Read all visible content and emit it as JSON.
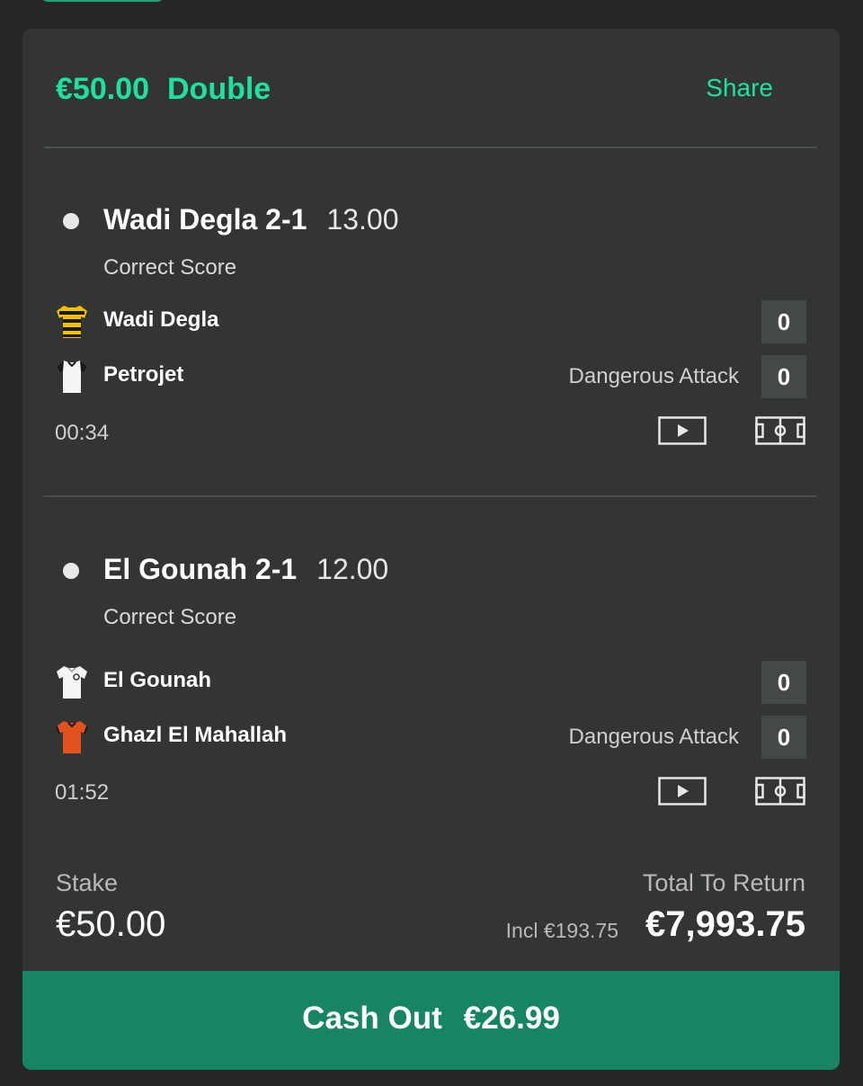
{
  "bet": {
    "amount": "€50.00",
    "type": "Double",
    "share_label": "Share"
  },
  "selections": [
    {
      "name": "Wadi Degla 2-1",
      "odds": "13.00",
      "market": "Correct Score",
      "home": {
        "team": "Wadi Degla",
        "score": "0",
        "kit": "yellow-black-striped-shirt-icon"
      },
      "away": {
        "team": "Petrojet",
        "score": "0",
        "kit": "white-black-shirt-icon"
      },
      "event": "Dangerous Attack",
      "clock": "00:34"
    },
    {
      "name": "El Gounah 2-1",
      "odds": "12.00",
      "market": "Correct Score",
      "home": {
        "team": "El Gounah",
        "score": "0",
        "kit": "white-shirt-icon"
      },
      "away": {
        "team": "Ghazl El Mahallah",
        "score": "0",
        "kit": "orange-shirt-icon"
      },
      "event": "Dangerous Attack",
      "clock": "01:52"
    }
  ],
  "summary": {
    "stake_label": "Stake",
    "stake_value": "€50.00",
    "return_label": "Total To Return",
    "incl_text": "Incl €193.75",
    "return_value": "€7,993.75"
  },
  "cashout": {
    "label": "Cash Out",
    "value": "€26.99"
  },
  "colors": {
    "accent": "#1fe0a0",
    "cashout_bg": "#178564",
    "card_bg": "#323534",
    "page_bg": "#262727"
  }
}
